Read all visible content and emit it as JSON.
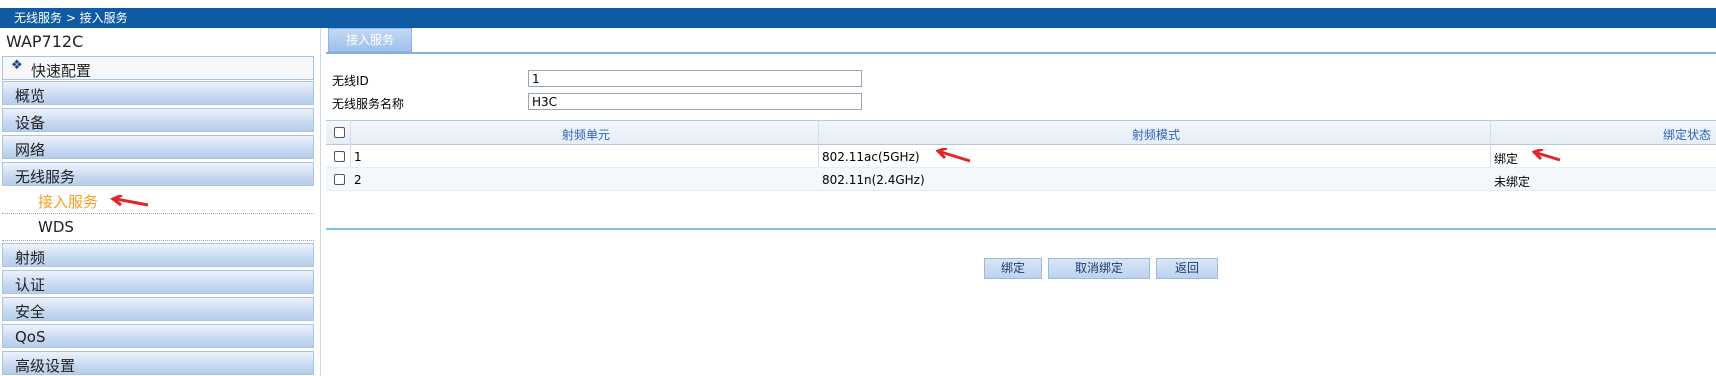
{
  "breadcrumb": "无线服务 > 接入服务",
  "sidebar": {
    "device_name": "WAP712C",
    "quick_config": "快速配置",
    "items": [
      {
        "label": "概览"
      },
      {
        "label": "设备"
      },
      {
        "label": "网络"
      },
      {
        "label": "无线服务"
      }
    ],
    "sub_items": [
      {
        "label": "接入服务",
        "active": true
      },
      {
        "label": "WDS",
        "active": false
      }
    ],
    "items_after": [
      {
        "label": "射频"
      },
      {
        "label": "认证"
      },
      {
        "label": "安全"
      },
      {
        "label": "QoS"
      },
      {
        "label": "高级设置"
      }
    ]
  },
  "tab": {
    "label": "接入服务"
  },
  "form": {
    "wireless_id_label": "无线ID",
    "wireless_id_value": "1",
    "service_name_label": "无线服务名称",
    "service_name_value": "H3C"
  },
  "table": {
    "headers": [
      "射频单元",
      "射频模式",
      "绑定状态"
    ],
    "rows": [
      {
        "unit": "1",
        "mode": "802.11ac(5GHz)",
        "status": "绑定"
      },
      {
        "unit": "2",
        "mode": "802.11n(2.4GHz)",
        "status": "未绑定"
      }
    ]
  },
  "buttons": {
    "bind": "绑定",
    "unbind": "取消绑定",
    "back": "返回"
  },
  "colors": {
    "topbar": "#0e5ba3",
    "active_subitem": "#f0a020",
    "annotation_arrow": "#e0262a"
  }
}
